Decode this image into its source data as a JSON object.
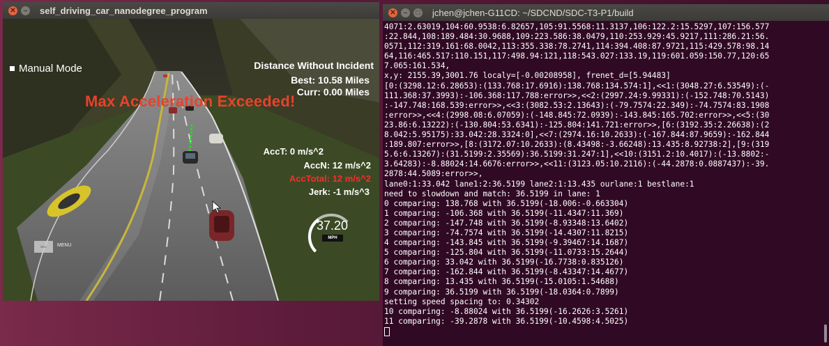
{
  "simulator": {
    "title": "self_driving_car_nanodegree_program",
    "hud": {
      "manual_mode": "Manual Mode",
      "distance_title": "Distance Without Incident",
      "best": "Best: 10.58 Miles",
      "curr": "Curr: 0.00 Miles",
      "warning": "Max Acceleration Exceeded!",
      "acc_t": "AccT: 0 m/s^2",
      "acc_n": "AccN: 12 m/s^2",
      "acc_total": "AccTotal: 12 m/s^2",
      "jerk": "Jerk: -1 m/s^3",
      "speed": "37.20",
      "speed_unit": "MPH",
      "speed_fraction": 0.37,
      "menu_label": "MENU",
      "menu_button_text": "ESC"
    }
  },
  "terminal": {
    "title": "jchen@jchen-G11CD: ~/SDCND/SDC-T3-P1/build",
    "lines": [
      "4071:2.63019,104:60.9538:6.82657,105:91.5568:11.3137,106:122.2:15.5297,107:156.577",
      ":22.844,108:189.484:30.9688,109:223.586:38.0479,110:253.929:45.9217,111:286.21:56.",
      "0571,112:319.161:68.0042,113:355.338:78.2741,114:394.408:87.9721,115:429.578:98.14",
      "64,116:465.517:110.151,117:498.94:121,118:543.027:133.19,119:601.059:150.77,120:65",
      "7.065:161.534,",
      "x,y: 2155.39,3001.76 localy=[-0.00208958], frenet_d=[5.94483]",
      "[0:(3298.12:6.28653):(133.768:17.6916):138.768:134.574:1],<<1:(3048.27:6.53549):(-",
      "111.368:37.3993):-106.368:117.788:error>>,<<2:(2997.24:9.99331):(-152.748:70.5143)",
      ":-147.748:168.539:error>>,<<3:(3082.53:2.13643):(-79.7574:22.349):-74.7574:83.1908",
      ":error>>,<<4:(2998.08:6.07059):(-148.845:72.0939):-143.845:165.702:error>>,<<5:(30",
      "23.86:6.13222):(-130.804:53.6341):-125.804:141.721:error>>,[6:(3192.35:2.26638):(2",
      "8.042:5.95175):33.042:28.3324:0],<<7:(2974.16:10.2633):(-167.844:87.9659):-162.844",
      ":189.807:error>>,[8:(3172.07:10.2633):(8.43498:-3.66248):13.435:8.92738:2],[9:(319",
      "5.6:6.13267):(31.5199:2.35569):36.5199:31.247:1],<<10:(3151.2:10.4017):(-13.8802:-",
      "3.64283):-8.88024:14.6676:error>>,<<11:(3123.05:10.2116):(-44.2878:0.0887437):-39.",
      "2878:44.5089:error>>,",
      "lane0:1:33.042 lane1:2:36.5199 lane2:1:13.435 ourlane:1 bestlane:1",
      "need to slowdown and match: 36.5199 in lane: 1",
      "0 comparing: 138.768 with 36.5199(-18.006:-0.663304)",
      "1 comparing: -106.368 with 36.5199(-11.4347:11.369)",
      "2 comparing: -147.748 with 36.5199(-8.93348:13.6402)",
      "3 comparing: -74.7574 with 36.5199(-14.4307:11.8215)",
      "4 comparing: -143.845 with 36.5199(-9.39467:14.1687)",
      "5 comparing: -125.804 with 36.5199(-11.0733:15.2644)",
      "6 comparing: 33.042 with 36.5199(-16.7738:0.835126)",
      "7 comparing: -162.844 with 36.5199(-8.43347:14.4677)",
      "8 comparing: 13.435 with 36.5199(-15.0105:1.54688)",
      "9 comparing: 36.5199 with 36.5199(-18.0364:0.7899)",
      "setting speed spacing to: 0.34302",
      "10 comparing: -8.88024 with 36.5199(-16.2626:3.5261)",
      "11 comparing: -39.2878 with 36.5199(-10.4598:4.5025)"
    ]
  }
}
